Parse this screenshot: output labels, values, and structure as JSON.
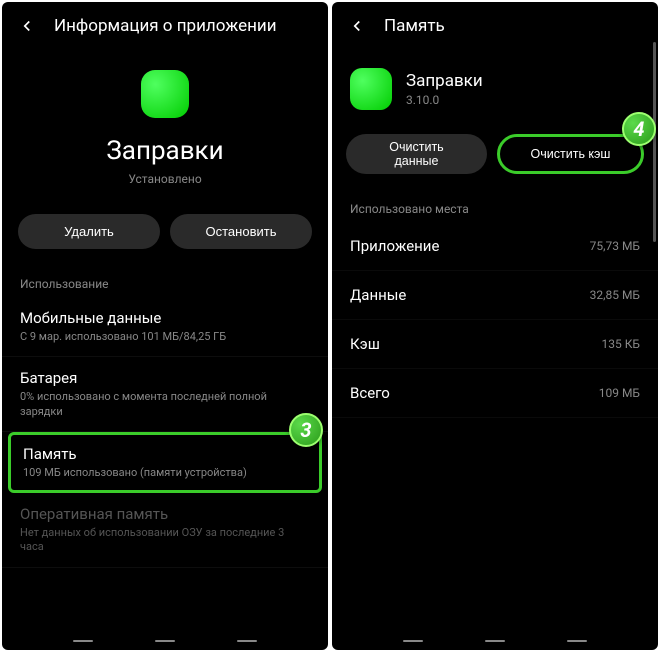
{
  "left": {
    "header_title": "Информация о приложении",
    "app_name": "Заправки",
    "app_status": "Установлено",
    "buttons": {
      "uninstall": "Удалить",
      "stop": "Остановить"
    },
    "section_label": "Использование",
    "items": {
      "mobile_data": {
        "title": "Мобильные данные",
        "sub": "С 9 мар. использовано 101 МБ/84,25 ГБ"
      },
      "battery": {
        "title": "Батарея",
        "sub": "0% использовано с момента последней полной зарядки"
      },
      "memory": {
        "title": "Память",
        "sub": "109 МБ использовано (памяти устройства)"
      },
      "ram": {
        "title": "Оперативная память",
        "sub": "Нет данных об использовании ОЗУ за последние 3 часа"
      }
    },
    "badge": "3"
  },
  "right": {
    "header_title": "Память",
    "app_name": "Заправки",
    "app_version": "3.10.0",
    "buttons": {
      "clear_data": "Очистить данные",
      "clear_cache": "Очистить кэш"
    },
    "section_label": "Использовано места",
    "rows": {
      "app": {
        "label": "Приложение",
        "value": "75,73 МБ"
      },
      "data": {
        "label": "Данные",
        "value": "32,85 МБ"
      },
      "cache": {
        "label": "Кэш",
        "value": "135 КБ"
      },
      "total": {
        "label": "Всего",
        "value": "109 МБ"
      }
    },
    "badge": "4"
  }
}
